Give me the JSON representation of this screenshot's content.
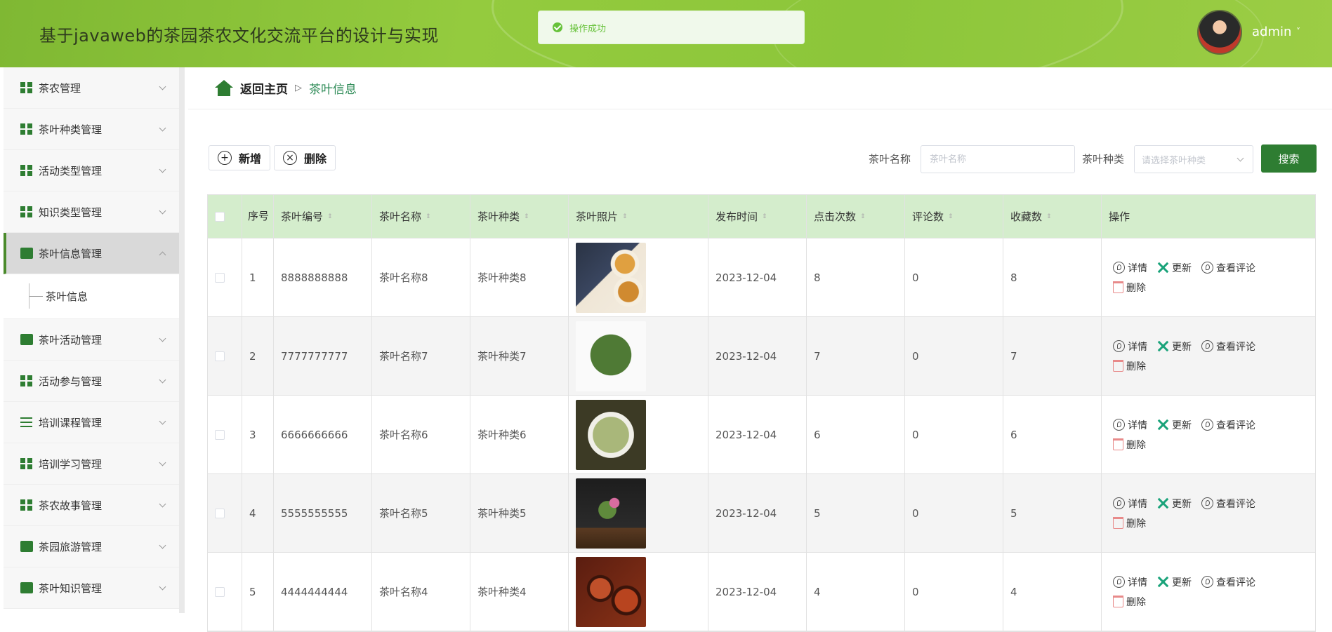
{
  "header": {
    "title": "基于javaweb的茶园茶农文化交流平台的设计与实现",
    "toast_text": "操作成功",
    "user_name": "admin",
    "user_caret": "˅"
  },
  "sidebar": {
    "items": [
      {
        "label": "茶农管理",
        "icon": "grid-icon"
      },
      {
        "label": "茶叶种类管理",
        "icon": "grid-icon"
      },
      {
        "label": "活动类型管理",
        "icon": "swap-icon"
      },
      {
        "label": "知识类型管理",
        "icon": "grid-icon"
      },
      {
        "label": "茶叶信息管理",
        "icon": "chat-icon",
        "active": true
      },
      {
        "label": "茶叶信息",
        "sub": true
      },
      {
        "label": "茶叶活动管理",
        "icon": "check-icon"
      },
      {
        "label": "活动参与管理",
        "icon": "grid-icon"
      },
      {
        "label": "培训课程管理",
        "icon": "list-icon"
      },
      {
        "label": "培训学习管理",
        "icon": "grid-icon"
      },
      {
        "label": "茶农故事管理",
        "icon": "grid-icon"
      },
      {
        "label": "茶园旅游管理",
        "icon": "thumb-icon"
      },
      {
        "label": "茶叶知识管理",
        "icon": "clipboard-icon"
      }
    ]
  },
  "breadcrumb": {
    "home": "返回主页",
    "separator": "▷",
    "current": "茶叶信息"
  },
  "toolbar": {
    "add_label": "新增",
    "delete_label": "删除"
  },
  "search": {
    "name_label": "茶叶名称",
    "name_placeholder": "茶叶名称",
    "type_label": "茶叶种类",
    "type_placeholder": "请选择茶叶种类",
    "button_label": "搜索"
  },
  "table": {
    "headers": [
      "序号",
      "茶叶编号",
      "茶叶名称",
      "茶叶种类",
      "茶叶照片",
      "发布时间",
      "点击次数",
      "评论数",
      "收藏数",
      "操作"
    ],
    "rows": [
      {
        "index": "1",
        "code": "8888888888",
        "name": "茶叶名称8",
        "type": "茶叶种类8",
        "photo": "photo-1",
        "date": "2023-12-04",
        "clicks": "8",
        "comments": "0",
        "favorites": "8"
      },
      {
        "index": "2",
        "code": "7777777777",
        "name": "茶叶名称7",
        "type": "茶叶种类7",
        "photo": "photo-2",
        "date": "2023-12-04",
        "clicks": "7",
        "comments": "0",
        "favorites": "7"
      },
      {
        "index": "3",
        "code": "6666666666",
        "name": "茶叶名称6",
        "type": "茶叶种类6",
        "photo": "photo-3",
        "date": "2023-12-04",
        "clicks": "6",
        "comments": "0",
        "favorites": "6"
      },
      {
        "index": "4",
        "code": "5555555555",
        "name": "茶叶名称5",
        "type": "茶叶种类5",
        "photo": "photo-4",
        "date": "2023-12-04",
        "clicks": "5",
        "comments": "0",
        "favorites": "5"
      },
      {
        "index": "5",
        "code": "4444444444",
        "name": "茶叶名称4",
        "type": "茶叶种类4",
        "photo": "photo-5",
        "date": "2023-12-04",
        "clicks": "4",
        "comments": "0",
        "favorites": "4"
      }
    ],
    "actions": {
      "detail": "详情",
      "update": "更新",
      "comments": "查看评论",
      "delete": "删除"
    }
  },
  "colors": {
    "brand_green": "#2e7d32",
    "header_green": "#8cc63a",
    "table_header_bg": "#d4edcc"
  }
}
